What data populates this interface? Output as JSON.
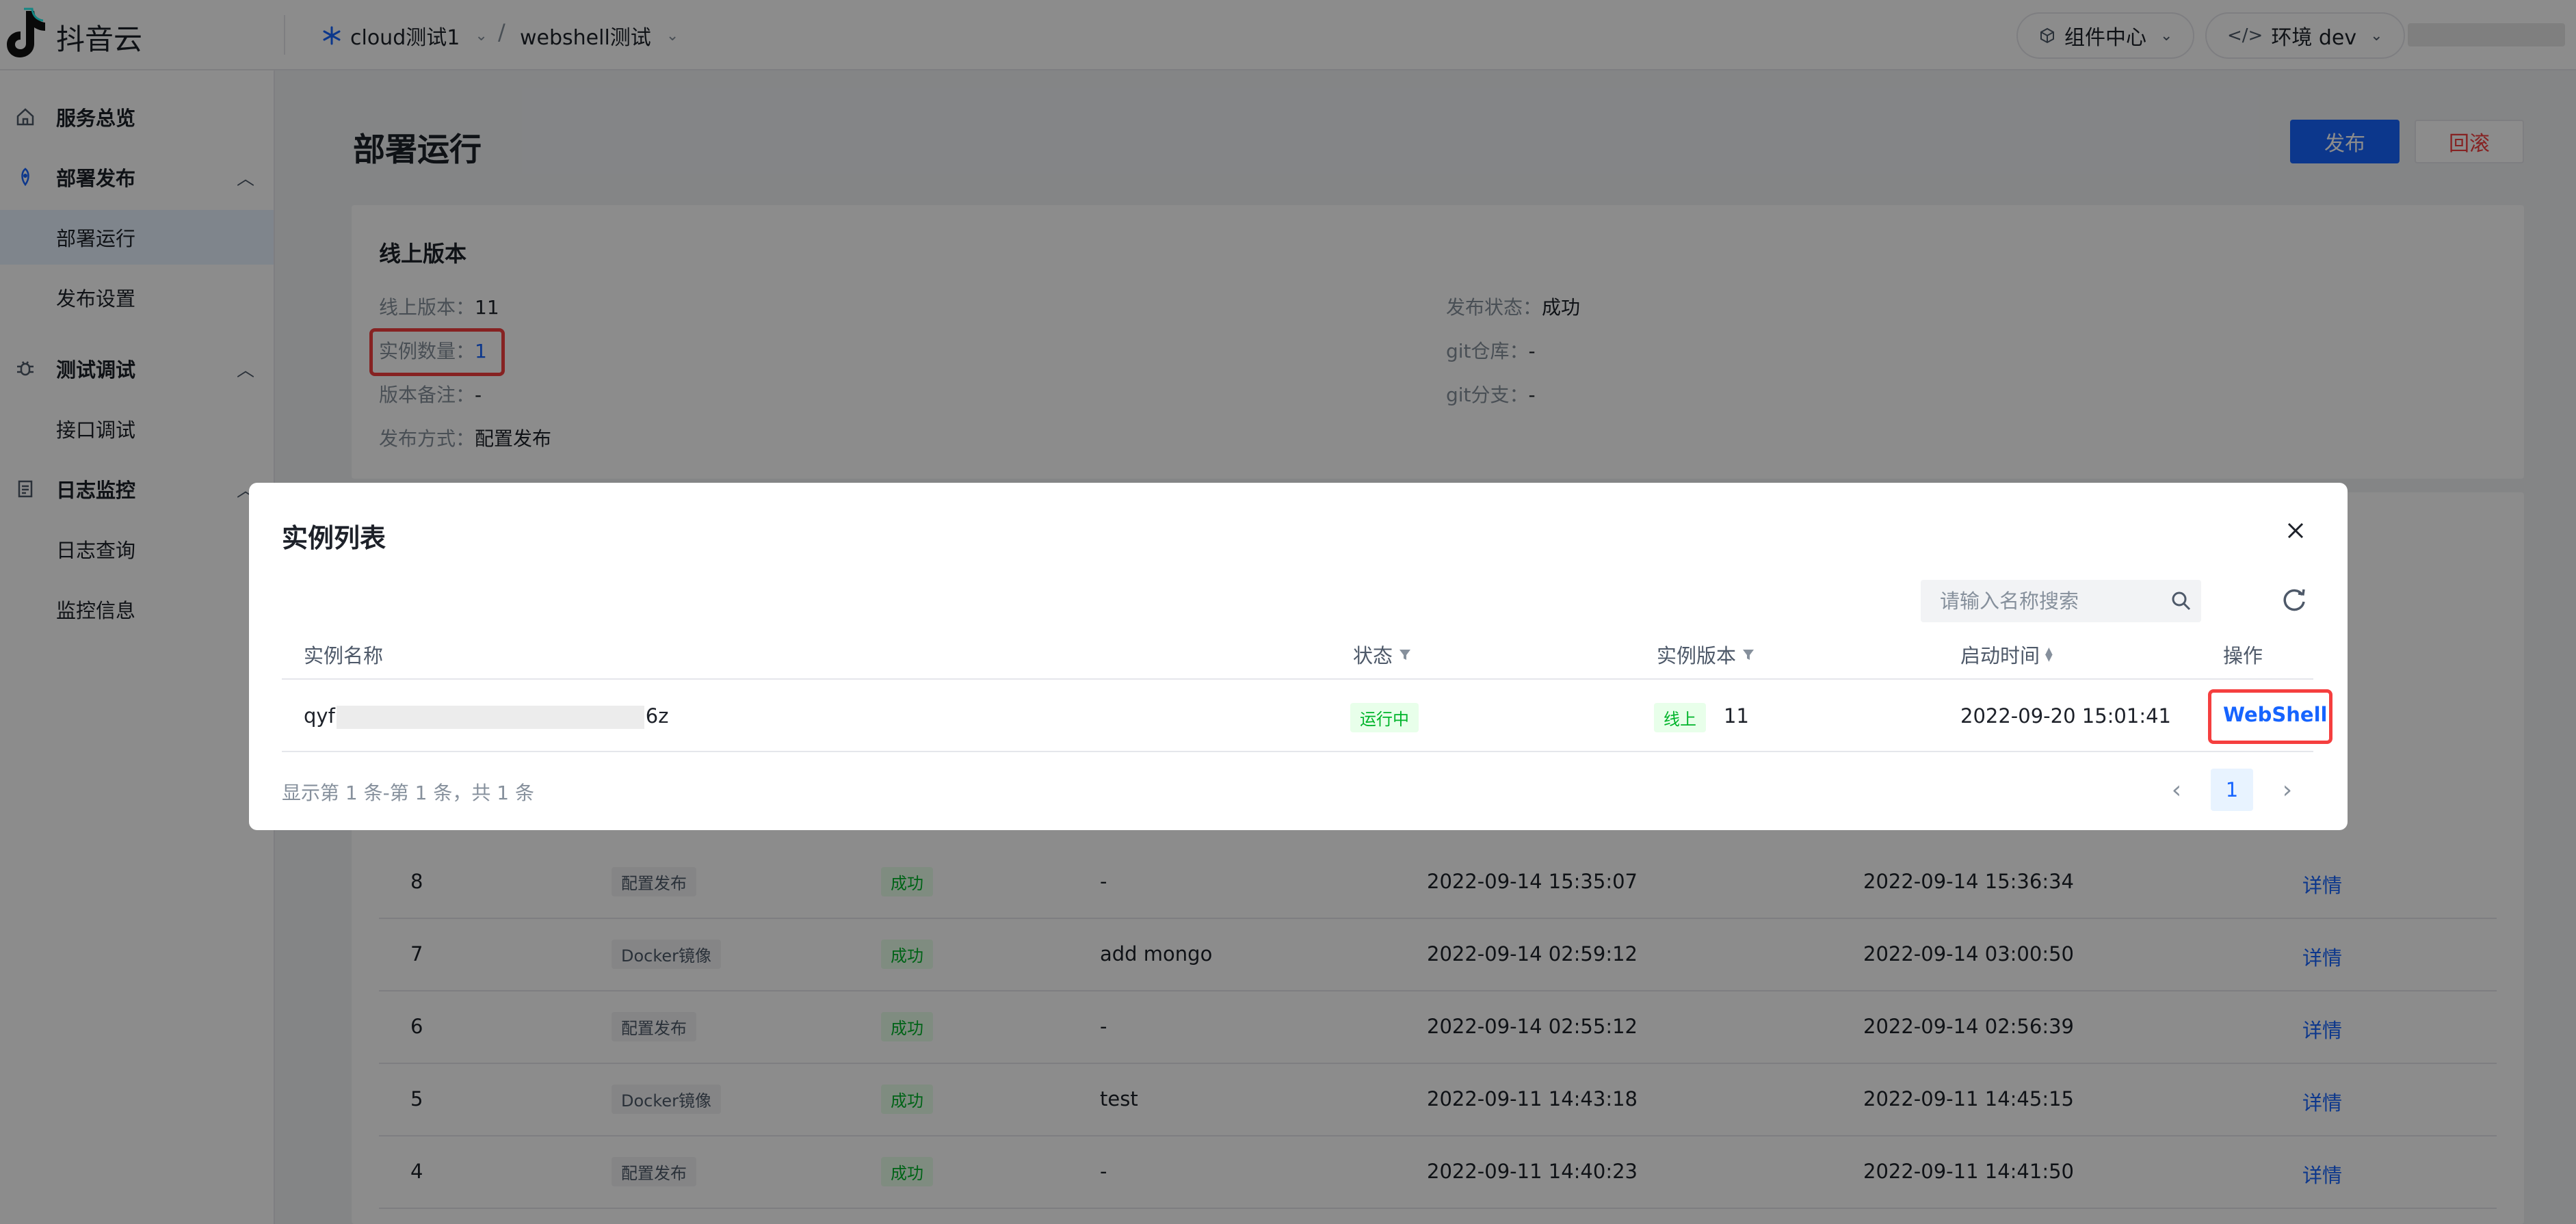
{
  "app": {
    "brand": "抖音云"
  },
  "breadcrumb": {
    "project": "cloud测试1",
    "separator": "/",
    "service": "webshell测试"
  },
  "header": {
    "components_label": "组件中心",
    "env_label": "环境 dev"
  },
  "sidebar": {
    "groups": [
      {
        "label": "服务总览",
        "icon": "home-icon"
      },
      {
        "label": "部署发布",
        "icon": "rocket-icon",
        "children": [
          "部署运行",
          "发布设置"
        ]
      },
      {
        "label": "测试调试",
        "icon": "bug-icon",
        "children": [
          "接口调试"
        ]
      },
      {
        "label": "日志监控",
        "icon": "file-icon",
        "children": [
          "日志查询",
          "监控信息"
        ]
      }
    ],
    "active": "部署运行"
  },
  "page": {
    "title": "部署运行",
    "publish_label": "发布",
    "rollback_label": "回滚"
  },
  "online_version": {
    "title": "线上版本",
    "version_key": "线上版本：",
    "version_val": "11",
    "instances_key": "实例数量：",
    "instances_val": "1",
    "note_key": "版本备注：",
    "note_val": "-",
    "method_key": "发布方式：",
    "method_val": "配置发布",
    "status_key": "发布状态：",
    "status_val": "成功",
    "git_repo_key": "git仓库：",
    "git_repo_val": "-",
    "git_branch_key": "git分支：",
    "git_branch_val": "-"
  },
  "history": {
    "rows": [
      {
        "version": "8",
        "method": "配置发布",
        "status": "成功",
        "note": "-",
        "start": "2022-09-14 15:35:07",
        "end": "2022-09-14 15:36:34",
        "action": "详情"
      },
      {
        "version": "7",
        "method": "Docker镜像",
        "status": "成功",
        "note": "add mongo",
        "start": "2022-09-14 02:59:12",
        "end": "2022-09-14 03:00:50",
        "action": "详情"
      },
      {
        "version": "6",
        "method": "配置发布",
        "status": "成功",
        "note": "-",
        "start": "2022-09-14 02:55:12",
        "end": "2022-09-14 02:56:39",
        "action": "详情"
      },
      {
        "version": "5",
        "method": "Docker镜像",
        "status": "成功",
        "note": "test",
        "start": "2022-09-11 14:43:18",
        "end": "2022-09-11 14:45:15",
        "action": "详情"
      },
      {
        "version": "4",
        "method": "配置发布",
        "status": "成功",
        "note": "-",
        "start": "2022-09-11 14:40:23",
        "end": "2022-09-11 14:41:50",
        "action": "详情"
      }
    ]
  },
  "modal": {
    "title": "实例列表",
    "search_placeholder": "请输入名称搜索",
    "columns": {
      "name": "实例名称",
      "status": "状态",
      "version": "实例版本",
      "start_time": "启动时间",
      "action": "操作"
    },
    "row": {
      "name_prefix": "qyf",
      "name_suffix": "6z",
      "status": "运行中",
      "version_tag": "线上",
      "version": "11",
      "start_time": "2022-09-20 15:01:41",
      "action": "WebShell"
    },
    "footer": "显示第 1 条-第 1 条，共 1 条",
    "current_page": "1"
  },
  "colors": {
    "primary": "#1664ff",
    "danger": "#f53f3f",
    "success": "#00b42a"
  }
}
